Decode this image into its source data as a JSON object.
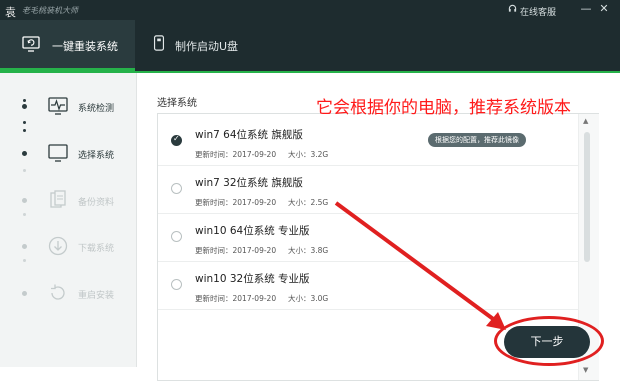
{
  "titlebar": {
    "app_title": "老毛桃装机大师",
    "support": "在线客服",
    "minimize": "—",
    "close": "✕"
  },
  "tabs": [
    {
      "label": "一键重装系统",
      "active": true
    },
    {
      "label": "制作启动U盘",
      "active": false
    }
  ],
  "steps": [
    {
      "label": "系统检测",
      "enabled": true
    },
    {
      "label": "选择系统",
      "enabled": true
    },
    {
      "label": "备份资料",
      "enabled": false
    },
    {
      "label": "下载系统",
      "enabled": false
    },
    {
      "label": "重启安装",
      "enabled": false
    }
  ],
  "main": {
    "section_title": "选择系统",
    "systems": [
      {
        "name": "win7 64位系统 旗舰版",
        "updated": "更新时间：2017-09-20",
        "size": "大小：3.2G",
        "selected": true,
        "badge": "根据您的配置，推荐此镜像"
      },
      {
        "name": "win7 32位系统 旗舰版",
        "updated": "更新时间：2017-09-20",
        "size": "大小：2.5G",
        "selected": false
      },
      {
        "name": "win10 64位系统 专业版",
        "updated": "更新时间：2017-09-20",
        "size": "大小：3.8G",
        "selected": false
      },
      {
        "name": "win10 32位系统 专业版",
        "updated": "更新时间：2017-09-20",
        "size": "大小：3.0G",
        "selected": false
      }
    ],
    "next_button": "下一步"
  },
  "annotation": "它会根据你的电脑，推荐系统版本",
  "colors": {
    "accent": "#26b24a",
    "dark": "#1e2c2f",
    "annotation": "#ff1a1a"
  }
}
